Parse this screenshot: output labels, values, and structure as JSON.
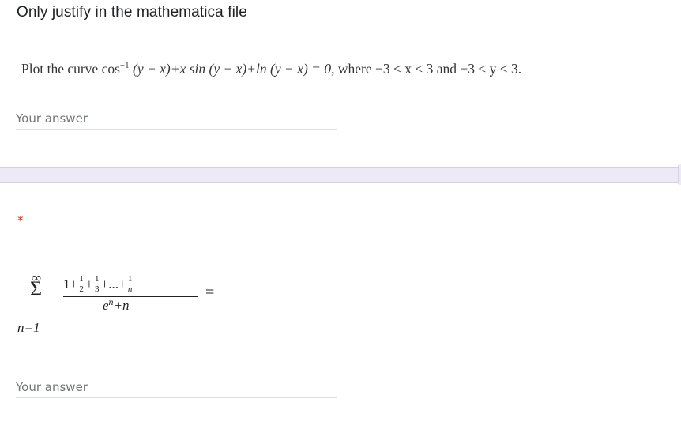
{
  "question1": {
    "title": "Only justify in the mathematica file",
    "text_prefix": "Plot the curve ",
    "text_equation_part1": "cos",
    "text_equation_sup": "−1",
    "text_equation_part2": " (y − x)+x sin (y − x)+ln (y − x) = 0",
    "text_suffix": ", where −3 < x < 3 and −3 < y < 3.",
    "answer_placeholder": "Your answer",
    "answer_value": ""
  },
  "question2": {
    "required_marker": "*",
    "formula": {
      "sum_upper": "∞",
      "sum_symbol": "Σ",
      "sum_lower": "n=1",
      "numerator_terms": [
        "1+",
        "1",
        "2",
        "+",
        "1",
        "3",
        "+...+",
        "1",
        "n"
      ],
      "denominator_base": "e",
      "denominator_exp": "n",
      "denominator_rest": "+n",
      "equals": "="
    },
    "answer_placeholder": "Your answer",
    "answer_value": ""
  },
  "colors": {
    "separator": "#ede9f7",
    "required": "#d93025",
    "placeholder": "#70757a"
  }
}
